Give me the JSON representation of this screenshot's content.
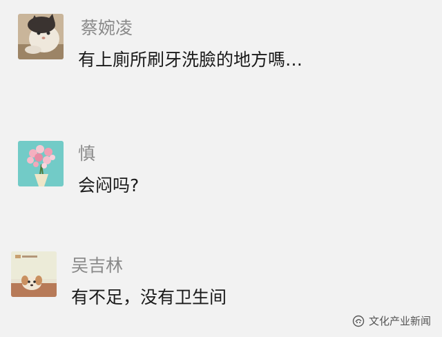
{
  "comments": [
    {
      "name": "蔡婉凌",
      "text": "有上廁所刷牙洗臉的地方嗎…",
      "avatar_icon": "cat-photo-avatar"
    },
    {
      "name": "慎",
      "text": "会闷吗?",
      "avatar_icon": "flower-bouquet-avatar"
    },
    {
      "name": "吴吉林",
      "text": "有不足，没有卫生间",
      "avatar_icon": "dog-photo-avatar"
    }
  ],
  "watermark": {
    "label": "文化产业新闻",
    "icon": "wechat-official-account-icon"
  },
  "colors": {
    "background": "#f2f2f2",
    "name": "#8a8a8a",
    "text": "#1a1a1a"
  }
}
